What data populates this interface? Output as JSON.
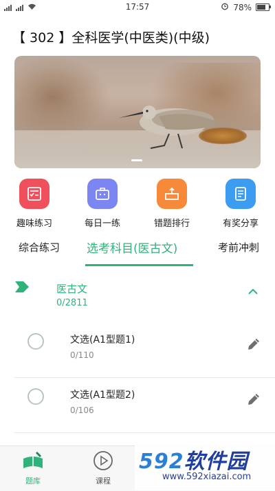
{
  "status_bar": {
    "time": "17:57",
    "battery": "78%",
    "battery_level": 0.78
  },
  "header": {
    "title": "【 302 】全科医学(中医类)(中级)"
  },
  "quick_actions": [
    {
      "label": "趣味练习",
      "icon": "checklist-icon",
      "color": "#f0505c"
    },
    {
      "label": "每日一练",
      "icon": "briefcase-icon",
      "color": "#7b86f2"
    },
    {
      "label": "错题排行",
      "icon": "ranking-icon",
      "color": "#f7893b"
    },
    {
      "label": "有奖分享",
      "icon": "notebook-icon",
      "color": "#3b9cf0"
    }
  ],
  "tabs": [
    {
      "label": "综合练习"
    },
    {
      "label": "选考科目(医古文)"
    },
    {
      "label": "考前冲刺"
    }
  ],
  "section": {
    "title": "医古文",
    "count": "0/2811"
  },
  "items": [
    {
      "title": "文选(A1型题1)",
      "count": "0/110"
    },
    {
      "title": "文选(A1型题2)",
      "count": "0/106"
    }
  ],
  "bottom_nav": [
    {
      "label": "题库",
      "icon": "book-pen-icon"
    },
    {
      "label": "课程",
      "icon": "play-circle-icon"
    }
  ],
  "watermark": {
    "brand_num": "592",
    "brand_cn": "软件园",
    "url": "www.592xiazai.com"
  },
  "colors": {
    "accent": "#2fb37a"
  }
}
